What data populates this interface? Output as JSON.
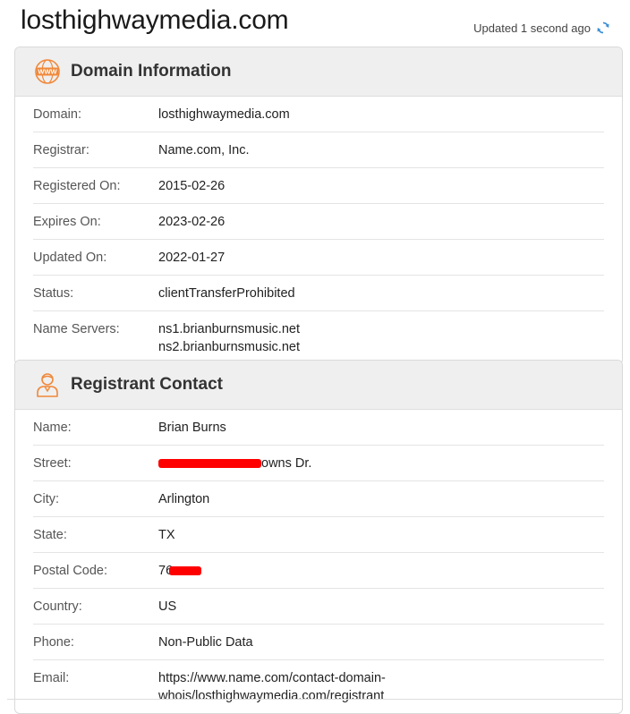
{
  "header": {
    "site_title": "losthighwaymedia.com",
    "updated_text": "Updated 1 second ago"
  },
  "domain_info": {
    "title": "Domain Information",
    "icon": "www-globe-icon",
    "accent_color": "#f0883a",
    "rows": [
      {
        "label": "Domain:",
        "value": "losthighwaymedia.com"
      },
      {
        "label": "Registrar:",
        "value": "Name.com, Inc."
      },
      {
        "label": "Registered On:",
        "value": "2015-02-26"
      },
      {
        "label": "Expires On:",
        "value": "2023-02-26"
      },
      {
        "label": "Updated On:",
        "value": "2022-01-27"
      },
      {
        "label": "Status:",
        "value": "clientTransferProhibited"
      }
    ],
    "name_servers": {
      "label": "Name Servers:",
      "values": [
        "ns1.brianburnsmusic.net",
        "ns2.brianburnsmusic.net"
      ]
    }
  },
  "registrant": {
    "title": "Registrant Contact",
    "icon": "person-icon",
    "name": {
      "label": "Name:",
      "value": "Brian Burns"
    },
    "street": {
      "label": "Street:",
      "visible_suffix": "owns Dr."
    },
    "city": {
      "label": "City:",
      "value": "Arlington"
    },
    "state": {
      "label": "State:",
      "value": "TX"
    },
    "postal": {
      "label": "Postal Code:",
      "visible_prefix": "76"
    },
    "country": {
      "label": "Country:",
      "value": "US"
    },
    "phone": {
      "label": "Phone:",
      "value": "Non-Public Data"
    },
    "email": {
      "label": "Email:",
      "lines": [
        "https://www.name.com/contact-domain-",
        "whois/losthighwaymedia.com/registrant"
      ]
    }
  },
  "colors": {
    "refresh": "#3b8fd6",
    "redaction": "#ff0000",
    "header_bg": "#efefef"
  }
}
